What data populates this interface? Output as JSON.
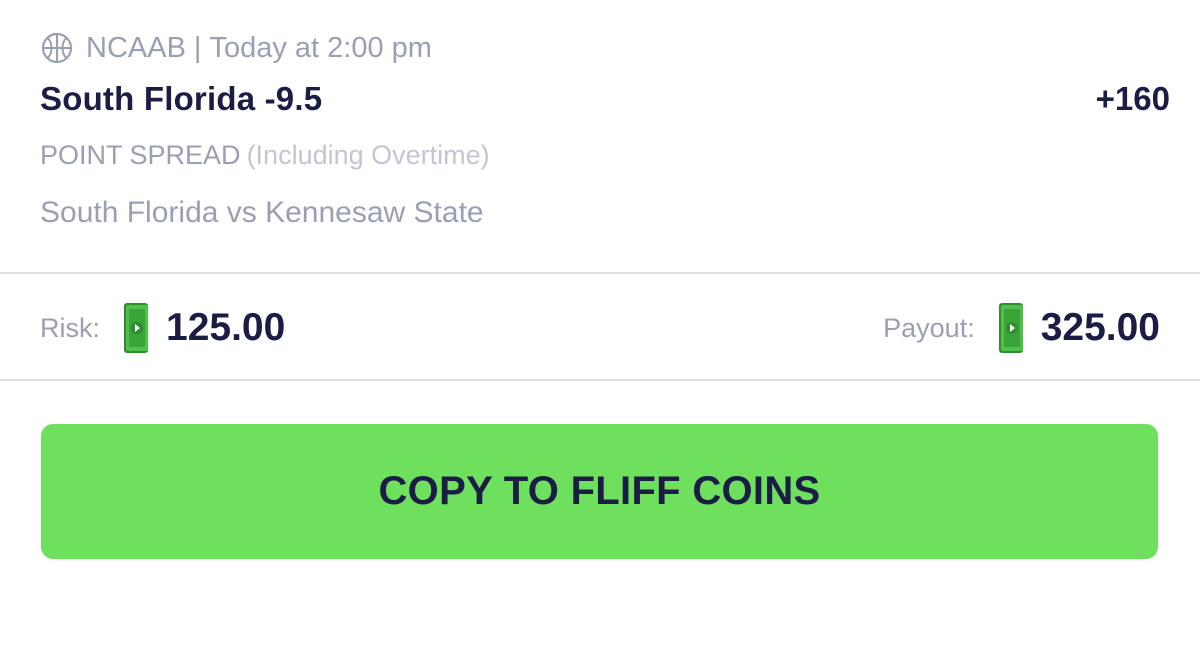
{
  "bet": {
    "league": "NCAAB",
    "separator": "|",
    "start_time": "Today at 2:00 pm",
    "sport_icon": "basketball-icon",
    "pick": "South Florida -9.5",
    "odds": "+160",
    "market": "POINT SPREAD",
    "market_qualifier": "(Including Overtime)",
    "matchup": "South Florida vs Kennesaw State"
  },
  "amounts": {
    "risk_label": "Risk:",
    "risk_value": "125.00",
    "payout_label": "Payout:",
    "payout_value": "325.00",
    "currency_icon": "cash-icon"
  },
  "actions": {
    "copy_label": "COPY TO FLIFF COINS"
  },
  "colors": {
    "primary_text": "#1c1d45",
    "muted_text": "#9aa0b4",
    "button_green": "#6ee05e",
    "cash_green": "#3aa33a"
  }
}
